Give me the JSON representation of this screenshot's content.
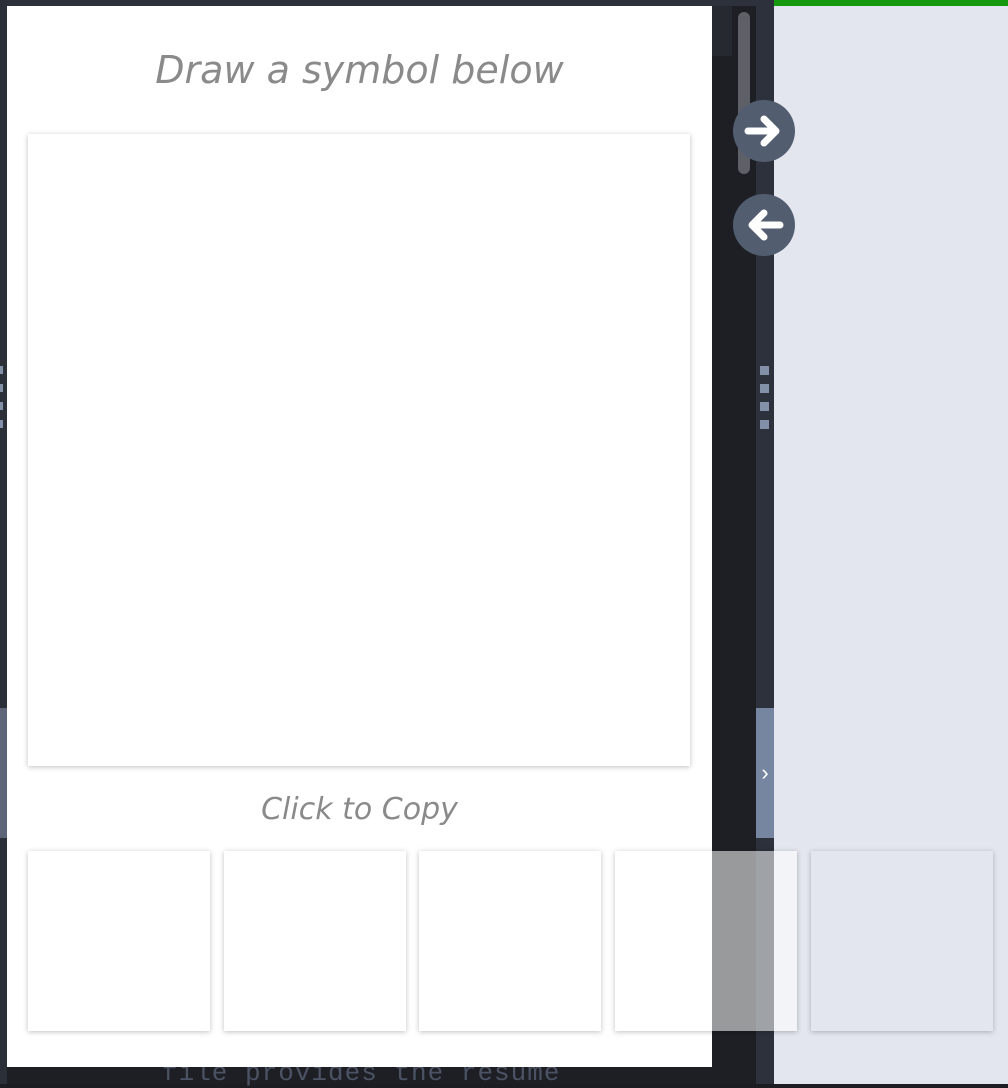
{
  "popup": {
    "title": "Draw a symbol below",
    "copy_label": "Click to Copy",
    "candidates": [
      "",
      "",
      "",
      "",
      ""
    ]
  },
  "editor": {
    "visible_code": "file provides the resume"
  },
  "nav": {
    "next_icon": "arrow-right-icon",
    "prev_icon": "arrow-left-icon"
  },
  "splitter": {
    "collapse_glyph": "›"
  },
  "colors": {
    "progress": "#17990f",
    "right_panel": "#e3e6ef",
    "nav_button": "#525d70"
  }
}
